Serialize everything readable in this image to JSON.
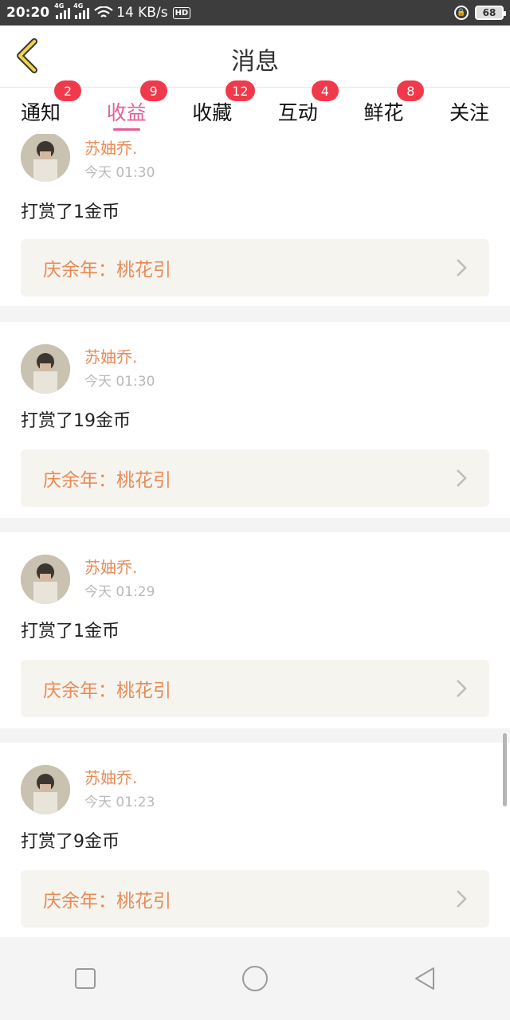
{
  "status_bar": {
    "time": "20:20",
    "network1": "4G",
    "network2": "4G",
    "speed": "14 KB/s",
    "hd": "HD",
    "battery": "68"
  },
  "header": {
    "title": "消息"
  },
  "tabs": [
    {
      "label": "通知",
      "badge": "2"
    },
    {
      "label": "收益",
      "badge": "9"
    },
    {
      "label": "收藏",
      "badge": "12"
    },
    {
      "label": "互动",
      "badge": "4"
    },
    {
      "label": "鲜花",
      "badge": "8"
    },
    {
      "label": "关注",
      "badge": ""
    }
  ],
  "active_tab": "收益",
  "messages": [
    {
      "user": "苏妯乔.",
      "time": "今天 01:30",
      "action": "打赏了1金币",
      "book": "庆余年：桃花引"
    },
    {
      "user": "苏妯乔.",
      "time": "今天 01:30",
      "action": "打赏了19金币",
      "book": "庆余年：桃花引"
    },
    {
      "user": "苏妯乔.",
      "time": "今天 01:29",
      "action": "打赏了1金币",
      "book": "庆余年：桃花引"
    },
    {
      "user": "苏妯乔.",
      "time": "今天 01:23",
      "action": "打赏了9金币",
      "book": "庆余年：桃花引"
    }
  ],
  "colors": {
    "accent_pink": "#e46096",
    "badge_red": "#f0394a",
    "orange_text": "#ea8a55",
    "back_arrow": "#f3d54a"
  },
  "icons": {
    "back": "chevron-left-icon",
    "nav_recent": "square-icon",
    "nav_home": "circle-icon",
    "nav_back": "triangle-back-icon"
  }
}
